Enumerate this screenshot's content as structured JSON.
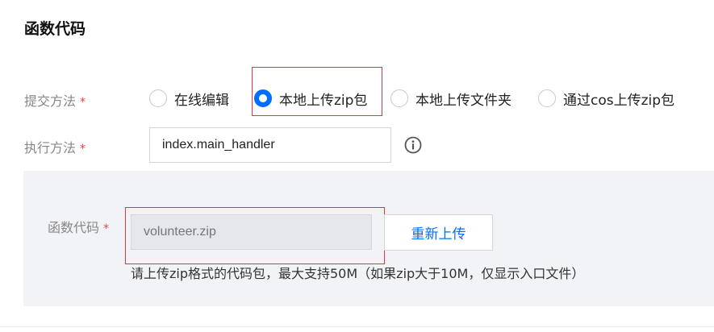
{
  "section": {
    "title": "函数代码"
  },
  "submit_method": {
    "label": "提交方法",
    "required_mark": "*",
    "options": [
      {
        "label": "在线编辑",
        "selected": false
      },
      {
        "label": "本地上传zip包",
        "selected": true
      },
      {
        "label": "本地上传文件夹",
        "selected": false
      },
      {
        "label": "通过cos上传zip包",
        "selected": false
      }
    ]
  },
  "exec_method": {
    "label": "执行方法",
    "required_mark": "*",
    "value": "index.main_handler",
    "info_icon": "info-icon"
  },
  "function_code": {
    "label": "函数代码",
    "required_mark": "*",
    "file_placeholder": "volunteer.zip",
    "reupload_label": "重新上传",
    "hint": "请上传zip格式的代码包，最大支持50M（如果zip大于10M，仅显示入口文件）"
  },
  "colors": {
    "accent": "#006eff",
    "required": "#e54545",
    "highlight": "#e0363f",
    "panel_bg": "#f2f3f6"
  }
}
